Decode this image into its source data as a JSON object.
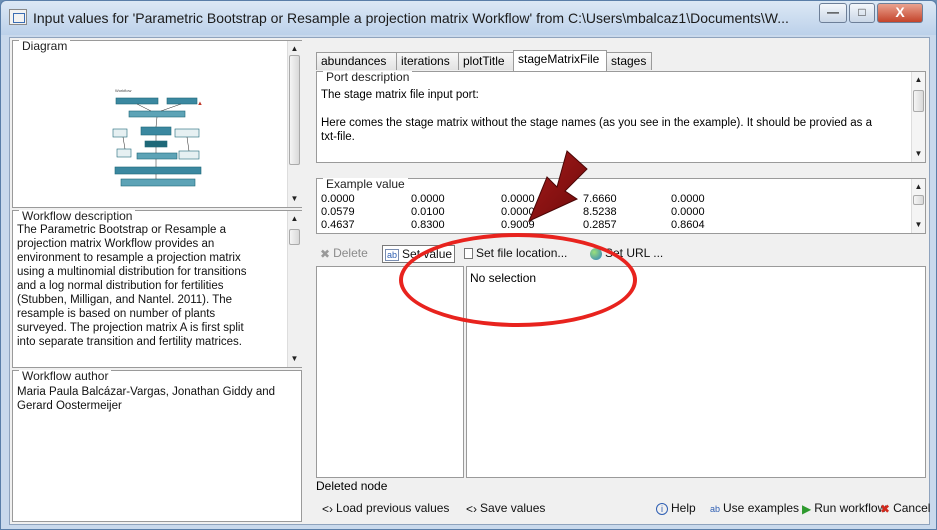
{
  "window": {
    "title": "Input values for 'Parametric Bootstrap or Resample a projection matrix Workflow' from C:\\Users\\mbalcaz1\\Documents\\W...",
    "min_glyph": "—",
    "max_glyph": "□",
    "close_glyph": "X"
  },
  "diagram": {
    "legend": "Diagram"
  },
  "description": {
    "legend": "Workflow description",
    "lines": [
      "The Parametric Bootstrap or Resample a",
      "projection matrix Workflow provides an",
      "environment to resample a projection matrix",
      "using a multinomial distribution for transitions",
      "and a log normal distribution for fertilities",
      "(Stubben, Milligan, and Nantel. 2011). The",
      "resample is based on number of plants",
      "surveyed. The projection matrix A is first split",
      "into separate transition and fertility matrices."
    ]
  },
  "author": {
    "legend": "Workflow author",
    "lines": [
      "Maria Paula Balcázar-Vargas, Jonathan Giddy and",
      "Gerard Oostermeijer"
    ]
  },
  "tabs": [
    "abundances",
    "iterations",
    "plotTitle",
    "stageMatrixFile",
    "stages"
  ],
  "active_tab": 3,
  "port_description": {
    "legend": "Port description",
    "line1": "The stage matrix file input port:",
    "line2": "Here comes the stage matrix without the stage names (as you see in the example).  It should be provied as a",
    "line3": "txt-file."
  },
  "example_value": {
    "legend": "Example value",
    "rows": [
      [
        "0.0000",
        "0.0000",
        "0.0000",
        "7.6660",
        "0.0000"
      ],
      [
        "0.0579",
        "0.0100",
        "0.0000",
        "8.5238",
        "0.0000"
      ],
      [
        "0.4637",
        "0.8300",
        "0.9009",
        "0.2857",
        "0.8604"
      ]
    ]
  },
  "toolbar": {
    "delete": "Delete",
    "set_value": "Set value",
    "set_file_location": "Set file location...",
    "set_url": "Set URL ..."
  },
  "value_panel": {
    "no_selection": "No selection"
  },
  "status": {
    "text": "Deleted node"
  },
  "footer": {
    "load_previous": "Load previous values",
    "save_values": "Save values",
    "help": "Help",
    "use_examples": "Use examples",
    "run_workflow": "Run workflow",
    "cancel": "Cancel"
  },
  "colors": {
    "annotation_red": "#e8231e",
    "annotation_arrow": "#8b0d0d",
    "run_green": "#2e9a2e",
    "cancel_red": "#d32a1e",
    "help_blue": "#2f5fb3"
  }
}
